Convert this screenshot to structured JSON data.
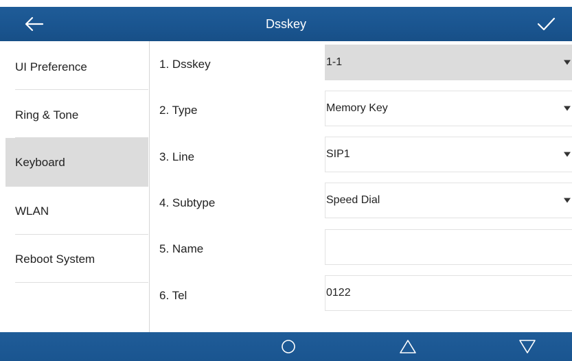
{
  "header": {
    "title": "Dsskey",
    "back_icon": "arrow-left-icon",
    "confirm_icon": "check-icon"
  },
  "sidebar": {
    "items": [
      {
        "label": "UI Preference",
        "active": false
      },
      {
        "label": "Ring & Tone",
        "active": false
      },
      {
        "label": "Keyboard",
        "active": true
      },
      {
        "label": "WLAN",
        "active": false
      },
      {
        "label": "Reboot System",
        "active": false
      }
    ]
  },
  "form": {
    "rows": [
      {
        "label": "1. Dsskey",
        "value": "1-1",
        "dropdown": true,
        "selected": true
      },
      {
        "label": "2. Type",
        "value": "Memory Key",
        "dropdown": true,
        "selected": false
      },
      {
        "label": "3. Line",
        "value": "SIP1",
        "dropdown": true,
        "selected": false
      },
      {
        "label": "4. Subtype",
        "value": "Speed Dial",
        "dropdown": true,
        "selected": false
      },
      {
        "label": "5. Name",
        "value": "",
        "dropdown": false,
        "selected": false
      },
      {
        "label": "6. Tel",
        "value": "0122",
        "dropdown": false,
        "selected": false
      }
    ]
  },
  "softkeys": [
    "circle-icon",
    "triangle-up-icon",
    "triangle-down-icon"
  ],
  "colors": {
    "bar_blue": "#1a5590",
    "active_gray": "#dcdcdc"
  }
}
